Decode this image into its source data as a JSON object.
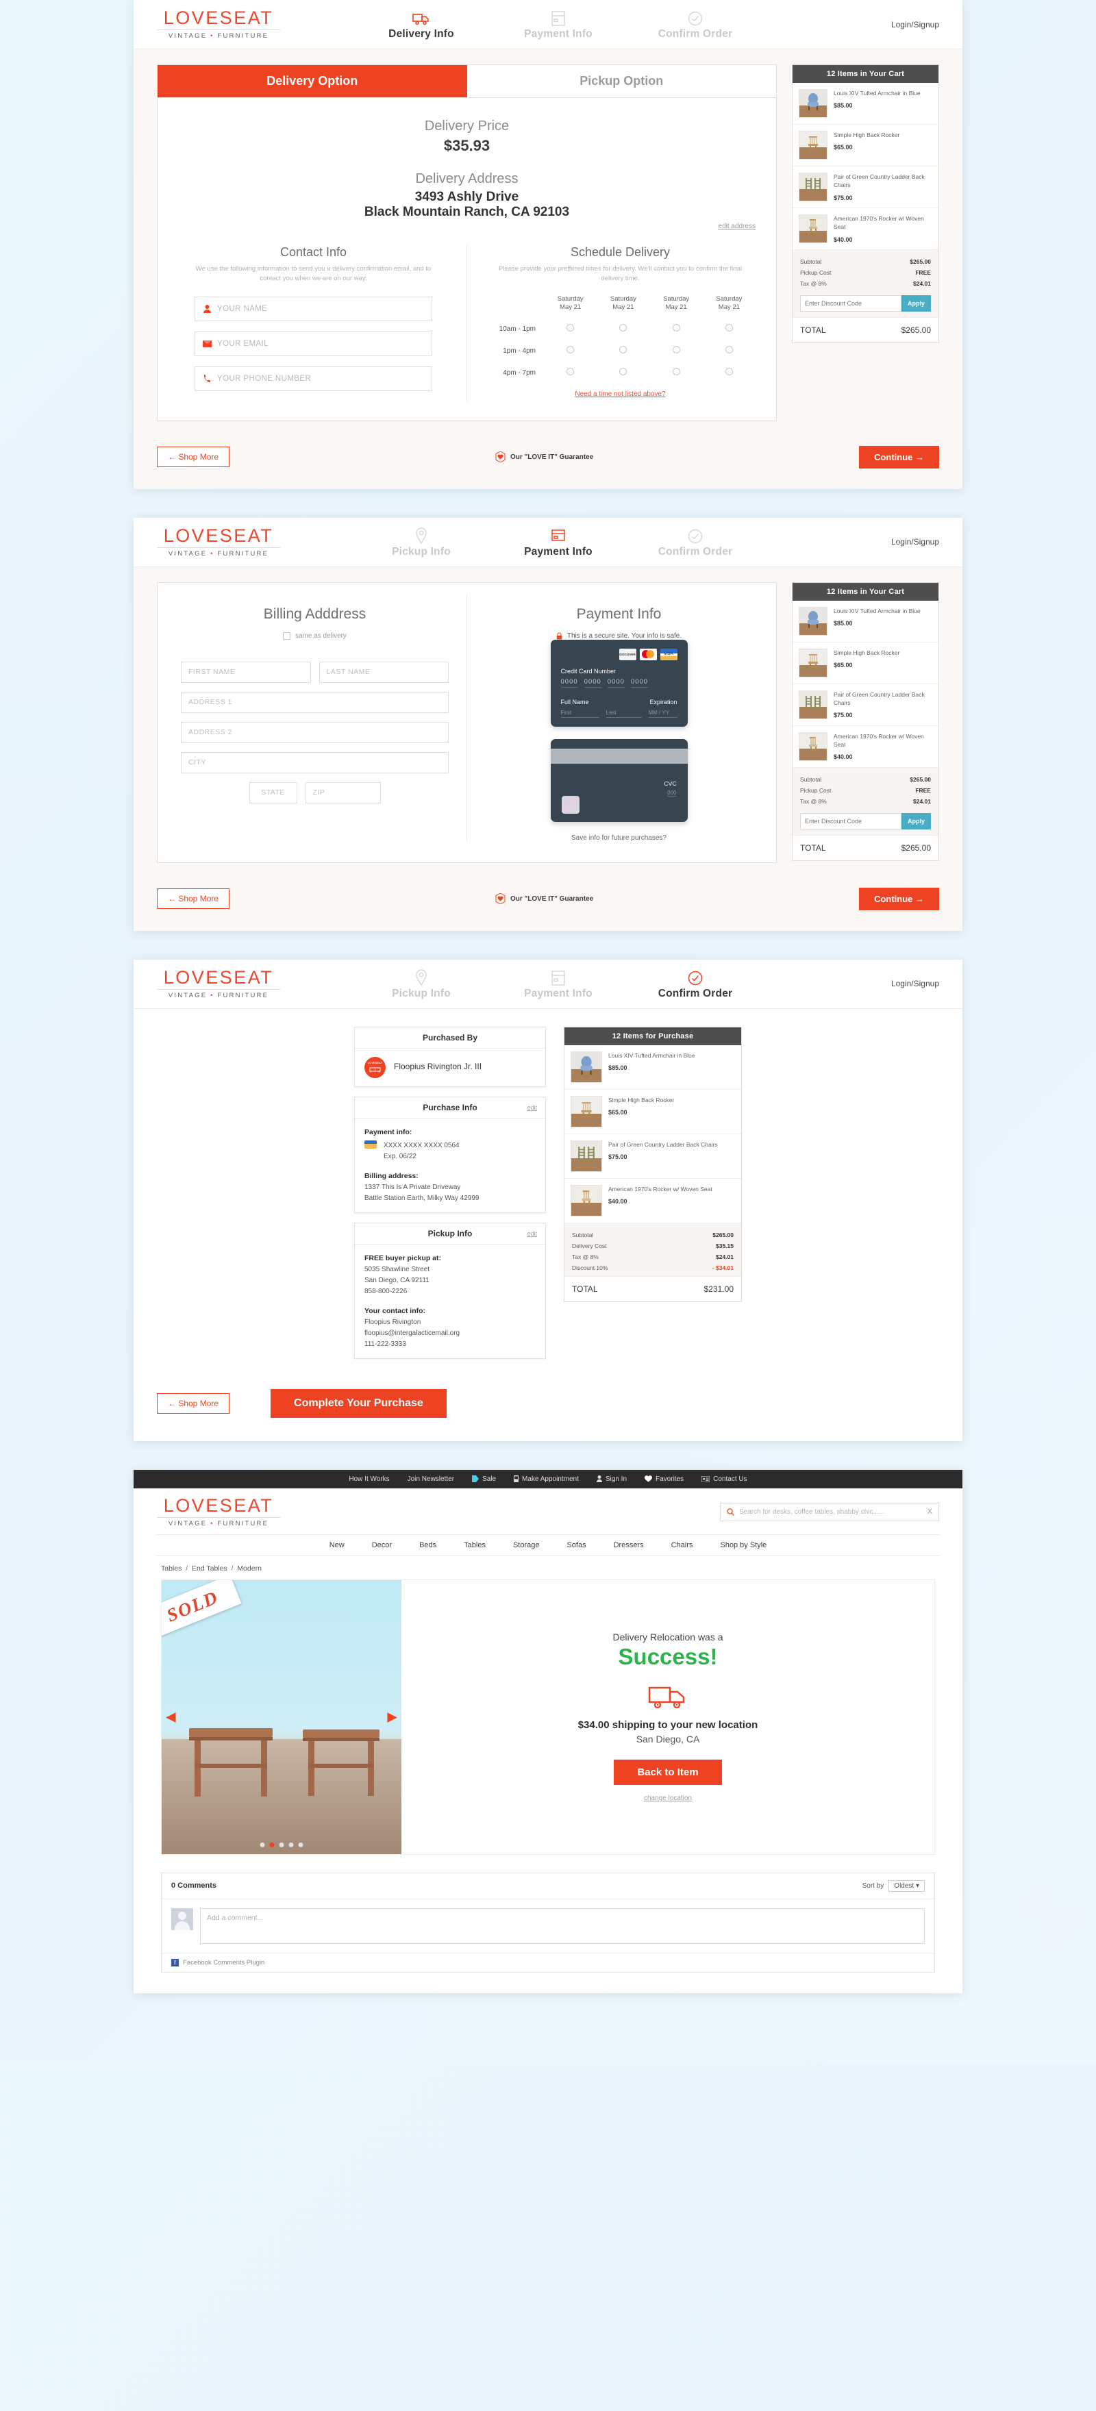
{
  "brand": {
    "name": "LOVESEAT",
    "tagline_left": "VINTAGE",
    "tagline_right": "FURNITURE",
    "accent": "#ee4323"
  },
  "checkout_header": {
    "login_label": "Login/Signup",
    "steps_delivery": [
      {
        "label": "Delivery Info",
        "icon": "truck-icon",
        "active": true
      },
      {
        "label": "Payment Info",
        "icon": "credit-card-icon",
        "active": false
      },
      {
        "label": "Confirm Order",
        "icon": "check-circle-icon",
        "active": false
      }
    ],
    "steps_payment": [
      {
        "label": "Pickup Info",
        "icon": "map-pin-icon",
        "active": false
      },
      {
        "label": "Payment Info",
        "icon": "credit-card-icon",
        "active": true
      },
      {
        "label": "Confirm Order",
        "icon": "check-circle-icon",
        "active": false
      }
    ],
    "steps_confirm": [
      {
        "label": "Pickup Info",
        "icon": "map-pin-icon",
        "active": false
      },
      {
        "label": "Payment Info",
        "icon": "credit-card-icon",
        "active": false
      },
      {
        "label": "Confirm Order",
        "icon": "check-circle-icon",
        "active": true
      }
    ]
  },
  "delivery": {
    "tab_delivery": "Delivery Option",
    "tab_pickup": "Pickup Option",
    "price_label": "Delivery Price",
    "price_value": "$35.93",
    "address_label": "Delivery Address",
    "address_line1": "3493 Ashly Drive",
    "address_line2": "Black Mountain Ranch, CA 92103",
    "edit_address": "edit address",
    "contact_title": "Contact Info",
    "contact_desc": "We use the following information to send you a delivery confirmation email, and to contact you when we are on our way.",
    "fields": [
      {
        "placeholder": "YOUR NAME",
        "icon": "person-icon"
      },
      {
        "placeholder": "YOUR EMAIL",
        "icon": "envelope-icon"
      },
      {
        "placeholder": "YOUR PHONE NUMBER",
        "icon": "phone-icon"
      }
    ],
    "schedule_title": "Schedule Delivery",
    "schedule_desc": "Please provide your preffered times for delivery. We'll contact you to confirm the final delivery time.",
    "schedule_days": [
      "Saturday\nMay 21",
      "Saturday\nMay 21",
      "Saturday\nMay 21",
      "Saturday\nMay 21"
    ],
    "schedule_slots": [
      "10am - 1pm",
      "1pm - 4pm",
      "4pm - 7pm"
    ],
    "need_time": "Need a time not listed above?"
  },
  "cart_delivery": {
    "header": "12 Items in Your Cart",
    "items": [
      {
        "name": "Louis XIV Tufted Armchair in Blue",
        "price": "$85.00",
        "thumb": "armchair-blue"
      },
      {
        "name": "Simple High Back Rocker",
        "price": "$65.00",
        "thumb": "rocker-wood"
      },
      {
        "name": "Pair of Green Country Ladder Back Chairs",
        "price": "$75.00",
        "thumb": "ladder-chairs"
      },
      {
        "name": "American 1970's Rocker w/ Woven Seat",
        "price": "$40.00",
        "thumb": "rocker-woven"
      }
    ],
    "totals": [
      {
        "label": "Subtotal",
        "value": "$265.00",
        "negative": false
      },
      {
        "label": "Pickup Cost",
        "value": "FREE",
        "negative": false
      },
      {
        "label": "Tax @ 8%",
        "value": "$24.01",
        "negative": false
      }
    ],
    "discount_placeholder": "Enter Discount Code",
    "apply_label": "Apply",
    "total_label": "TOTAL",
    "total_value": "$265.00"
  },
  "cart_confirm": {
    "header": "12 Items for Purchase",
    "items": [
      {
        "name": "Louis XIV Tufted Armchair in Blue",
        "price": "$85.00",
        "thumb": "armchair-blue"
      },
      {
        "name": "Simple High Back Rocker",
        "price": "$65.00",
        "thumb": "rocker-wood"
      },
      {
        "name": "Pair of Green Country Ladder Back Chairs",
        "price": "$75.00",
        "thumb": "ladder-chairs"
      },
      {
        "name": "American 1970's Rocker w/ Woven Seat",
        "price": "$40.00",
        "thumb": "rocker-woven"
      }
    ],
    "totals": [
      {
        "label": "Subtotal",
        "value": "$265.00",
        "negative": false
      },
      {
        "label": "Delivery Cost",
        "value": "$35.15",
        "negative": false
      },
      {
        "label": "Tax @ 8%",
        "value": "$24.01",
        "negative": false
      },
      {
        "label": "Discount 10%",
        "value": "- $34.01",
        "negative": true
      }
    ],
    "total_label": "TOTAL",
    "total_value": "$231.00"
  },
  "footer_bar": {
    "shop_more": "← Shop More",
    "guarantee": "Our \"LOVE IT\" Guarantee",
    "continue": "Continue →",
    "complete": "Complete Your Purchase"
  },
  "payment": {
    "billing_title": "Billing Adddress",
    "same_as_delivery": "same as delivery",
    "first_name": "FIRST NAME",
    "last_name": "LAST NAME",
    "address1": "ADDRESS 1",
    "address2": "ADDRESS 2",
    "city": "CITY",
    "state": "STATE",
    "zip": "ZIP",
    "payment_title": "Payment Info",
    "secure_note": "This is a secure site. Your info is safe.",
    "brands": [
      "DISCOVER",
      "MASTERCARD",
      "VISA"
    ],
    "cc_label": "Credit Card Number",
    "cc_groups": [
      "0000",
      "0000",
      "0000",
      "0000"
    ],
    "fullname_label": "Full Name",
    "expiration_label": "Expiration",
    "first_ph": "First",
    "last_ph": "Last",
    "exp_ph": "MM / YY",
    "cvc_label": "CVC",
    "cvc_ph": "000",
    "save_info": "Save info for future purchases?"
  },
  "confirm": {
    "purchased_by_title": "Purchased By",
    "buyer_name": "Floopius Rivington Jr. III",
    "purchase_info_title": "Purchase Info",
    "edit_label": "edit",
    "payment_info_label": "Payment info:",
    "card_masked": "XXXX XXXX XXXX 0564",
    "card_exp": "Exp. 06/22",
    "billing_address_label": "Billing address:",
    "billing_line1": "1337 This Is A Private Driveway",
    "billing_line2": "Battle Station Earth, Milky Way 42999",
    "pickup_info_title": "Pickup Info",
    "pickup_label": "FREE buyer pickup at:",
    "pickup_line1": "5035 Shawline Street",
    "pickup_line2": "San Diego, CA 92111",
    "pickup_line3": "858-800-2226",
    "contact_label": "Your contact info:",
    "contact_line1": "Floopius Rivington",
    "contact_line2": "floopius@intergalacticemail.org",
    "contact_line3": "111-222-3333"
  },
  "site": {
    "topbar": [
      {
        "label": "How It Works",
        "icon": "none"
      },
      {
        "label": "Join Newsletter",
        "icon": "none"
      },
      {
        "label": "Sale",
        "icon": "tag-icon"
      },
      {
        "label": "Make Appointment",
        "icon": "phone-icon"
      },
      {
        "label": "Sign In",
        "icon": "person-icon"
      },
      {
        "label": "Favorites",
        "icon": "heart-icon"
      },
      {
        "label": "Contact Us",
        "icon": "contact-card-icon"
      }
    ],
    "search_placeholder": "Search for desks, coffee tables, shabby chic......",
    "search_clear": "X",
    "nav": [
      "New",
      "Decor",
      "Beds",
      "Tables",
      "Storage",
      "Sofas",
      "Dressers",
      "Chairs",
      "Shop by Style"
    ],
    "breadcrumb": [
      "Tables",
      "End Tables",
      "Modern"
    ],
    "sold_badge": "SOLD",
    "carousel_dots": 5,
    "carousel_active_index": 1,
    "relocation_sub": "Delivery Relocation was a",
    "relocation_success": "Success!",
    "relocation_ship": "$34.00 shipping to your new location",
    "relocation_city": "San Diego, CA",
    "back_to_item": "Back to Item",
    "change_location": "change location"
  },
  "comments": {
    "count_label": "0 Comments",
    "sort_by_label": "Sort by",
    "sort_value": "Oldest ▾",
    "add_placeholder": "Add a comment...",
    "plugin_label": "Facebook Comments Plugin"
  }
}
